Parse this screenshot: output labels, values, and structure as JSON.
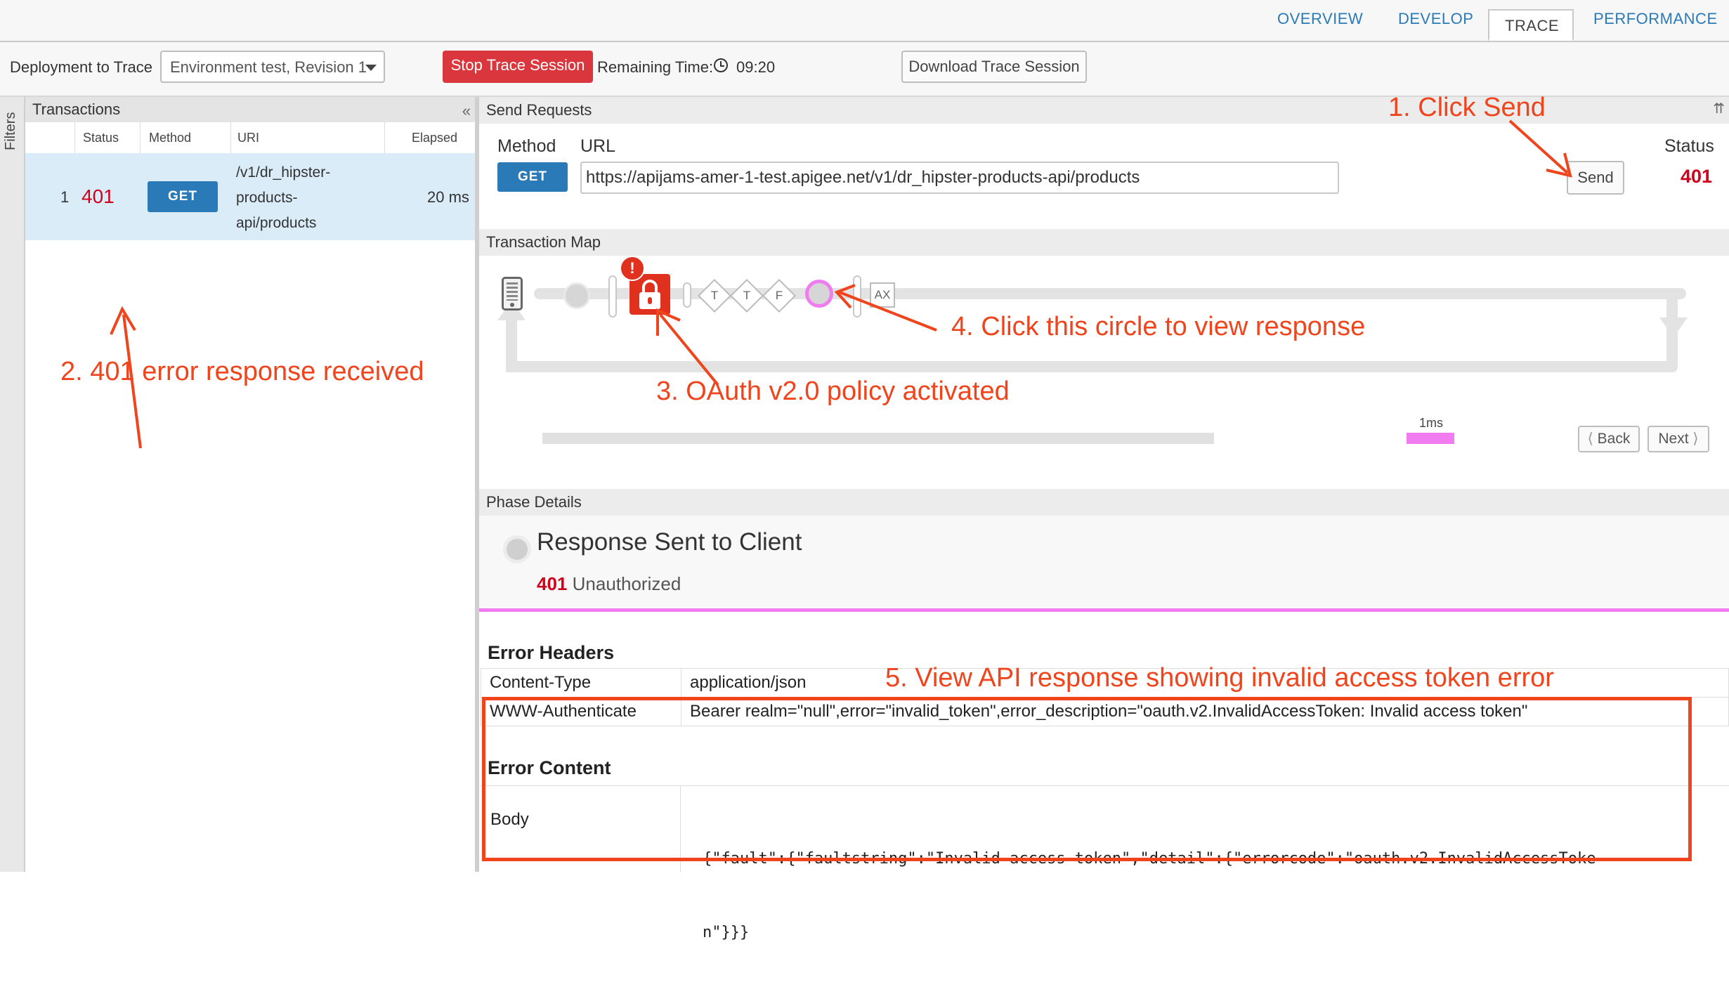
{
  "tabs": [
    "OVERVIEW",
    "DEVELOP",
    "TRACE",
    "PERFORMANCE"
  ],
  "toolbar": {
    "deployment_label": "Deployment to Trace",
    "deployment_value": "Environment test, Revision 1",
    "stop_label": "Stop Trace Session",
    "remaining_label": "Remaining Time:",
    "remaining_value": "09:20",
    "download_label": "Download Trace Session"
  },
  "filters_label": "Filters",
  "transactions": {
    "title": "Transactions",
    "columns": [
      "Status",
      "Method",
      "URI",
      "Elapsed"
    ],
    "row": {
      "index": "1",
      "status": "401",
      "method": "GET",
      "uri_lines": [
        "/v1/dr_hipster-",
        "products-",
        "api/products"
      ],
      "elapsed": "20 ms"
    }
  },
  "send": {
    "title": "Send Requests",
    "method_label": "Method",
    "url_label": "URL",
    "status_label": "Status",
    "method": "GET",
    "url": "https://apijams-amer-1-test.apigee.net/v1/dr_hipster-products-api/products",
    "send_label": "Send",
    "status": "401"
  },
  "map": {
    "title": "Transaction Map",
    "nodes": [
      "T",
      "T",
      "F",
      "AX"
    ],
    "timeline_label": "1ms",
    "back_label": "Back",
    "next_label": "Next"
  },
  "phase": {
    "title": "Phase Details",
    "heading": "Response Sent to Client",
    "code": "401",
    "status_text": "Unauthorized"
  },
  "errors": {
    "headers_title": "Error Headers",
    "headers": [
      {
        "name": "Content-Type",
        "value": "application/json"
      },
      {
        "name": "WWW-Authenticate",
        "value": "Bearer realm=\"null\",error=\"invalid_token\",error_description=\"oauth.v2.InvalidAccessToken: Invalid access token\""
      }
    ],
    "content_title": "Error Content",
    "body_label": "Body",
    "body_lines": [
      "{\"fault\":{\"faultstring\":\"Invalid access token\",\"detail\":{\"errorcode\":\"oauth.v2.InvalidAccessToke",
      "n\"}}}"
    ]
  },
  "annotations": {
    "a1": "1. Click Send",
    "a2": "2. 401 error response received",
    "a3": "3. OAuth v2.0 policy activated",
    "a4": "4. Click this circle to view response",
    "a5": "5. View API response showing invalid access token error"
  },
  "colors": {
    "accent": "#2a7ab8",
    "error": "#d0021b",
    "annotation": "#f0441c",
    "highlight": "#f07cf0"
  }
}
